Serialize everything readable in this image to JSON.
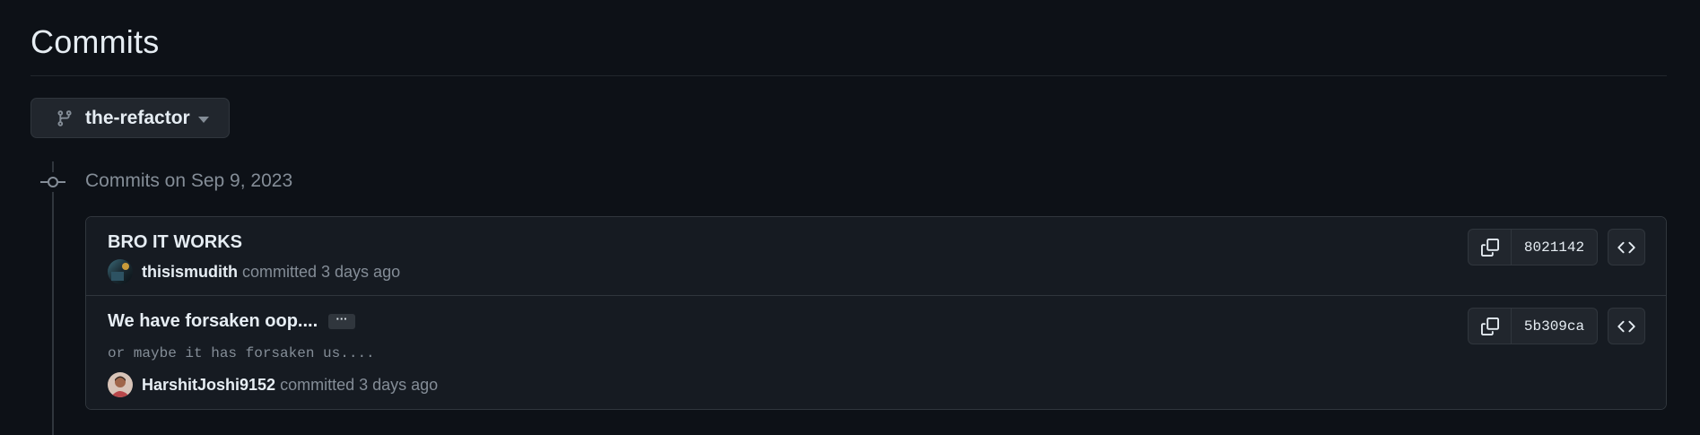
{
  "page": {
    "title": "Commits"
  },
  "branch_selector": {
    "label": "the-refactor",
    "icon": "git-branch-icon"
  },
  "timeline": {
    "date_heading": "Commits on Sep 9, 2023"
  },
  "commits": [
    {
      "title": "BRO IT WORKS",
      "author": "thisismudith",
      "time_text": "committed 3 days ago",
      "sha": "8021142",
      "has_description": false
    },
    {
      "title": "We have forsaken oop....",
      "ellipsis": "···",
      "description": "or maybe it has forsaken us....",
      "author": "HarshitJoshi9152",
      "time_text": "committed 3 days ago",
      "sha": "5b309ca",
      "has_description": true
    }
  ],
  "colors": {
    "background": "#0d1117",
    "card_background": "#161b22",
    "border": "#30363d",
    "button_background": "#21262d",
    "text_primary": "#e6edf3",
    "text_muted": "#848d97"
  }
}
